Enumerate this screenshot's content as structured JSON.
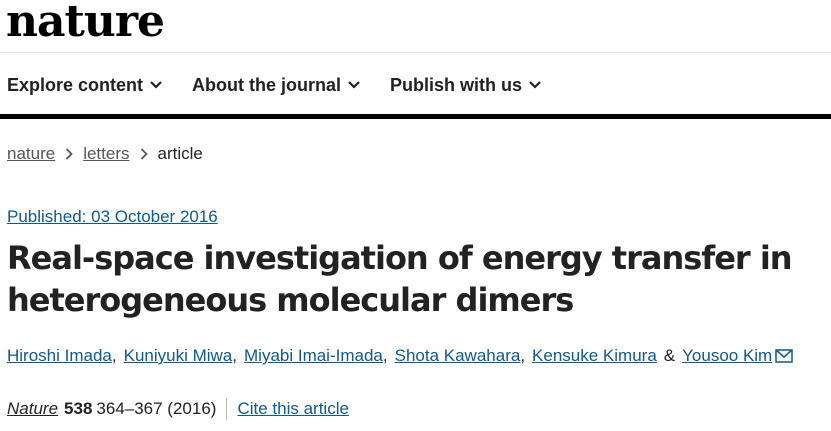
{
  "brand": {
    "logo_text": "nature"
  },
  "nav": {
    "items": [
      {
        "label": "Explore content"
      },
      {
        "label": "About the journal"
      },
      {
        "label": "Publish with us"
      }
    ]
  },
  "breadcrumb": {
    "items": [
      {
        "label": "nature"
      },
      {
        "label": "letters"
      },
      {
        "label": "article"
      }
    ]
  },
  "article": {
    "published": "Published: 03 October 2016",
    "title_line1": "Real-space investigation of energy transfer in",
    "title_line2": "heterogeneous molecular dimers",
    "authors": [
      {
        "name": "Hiroshi Imada"
      },
      {
        "name": "Kuniyuki Miwa"
      },
      {
        "name": "Miyabi Imai-Imada"
      },
      {
        "name": "Shota Kawahara"
      },
      {
        "name": "Kensuke Kimura"
      },
      {
        "name": "Yousoo Kim"
      }
    ],
    "author_separator": ",",
    "author_and": "&",
    "citation": {
      "journal": "Nature",
      "volume": "538",
      "pages": "364–367 (2016)",
      "cite_label": "Cite this article"
    }
  },
  "colors": {
    "link": "#0f5a8c",
    "text": "#222222",
    "rule": "#000000"
  }
}
